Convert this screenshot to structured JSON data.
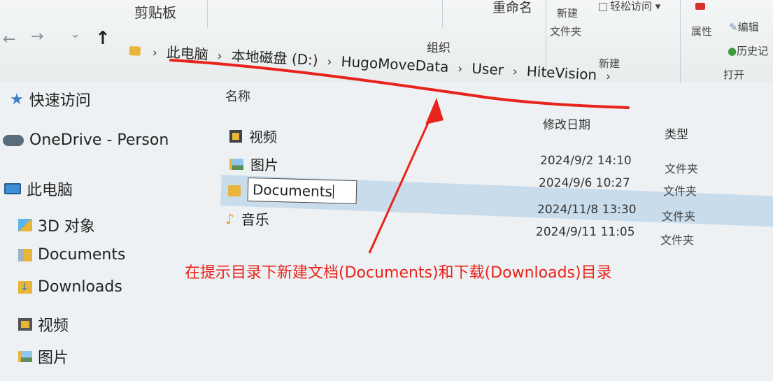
{
  "ribbon": {
    "clipboard_label": "剪贴板",
    "rename_label": "重命名",
    "new_folder_label_line1": "新建",
    "new_folder_label_line2": "文件夹",
    "easy_access_label": "轻松访问 ▾",
    "organize_group": "组织",
    "new_group": "新建",
    "properties_label": "属性",
    "edit_label": "编辑",
    "history_label": "历史记",
    "open_group": "打开"
  },
  "nav": {
    "back": "←",
    "forward": "→",
    "recent": "⌄",
    "up": "↑"
  },
  "breadcrumb": [
    "此电脑",
    "本地磁盘 (D:)",
    "HugoMoveData",
    "User",
    "HiteVision"
  ],
  "breadcrumb_sep": "›",
  "sidebar": {
    "items": [
      {
        "label": "快速访问",
        "icon": "star-icon"
      },
      {
        "label": "OneDrive - Person",
        "icon": "cloud-icon"
      },
      {
        "label": "此电脑",
        "icon": "computer-icon"
      },
      {
        "label": "3D 对象",
        "icon": "cube-icon"
      },
      {
        "label": "Documents",
        "icon": "document-folder-icon"
      },
      {
        "label": "Downloads",
        "icon": "download-folder-icon"
      },
      {
        "label": "视频",
        "icon": "video-folder-icon"
      },
      {
        "label": "图片",
        "icon": "picture-folder-icon"
      }
    ]
  },
  "columns": {
    "name": "名称",
    "modified": "修改日期",
    "type": "类型"
  },
  "files": [
    {
      "name": "视频",
      "date": "2024/9/2 14:10",
      "type": "文件夹",
      "icon": "video-folder-icon"
    },
    {
      "name": "图片",
      "date": "2024/9/6 10:27",
      "type": "文件夹",
      "icon": "picture-folder-icon"
    },
    {
      "name": "Documents",
      "date": "2024/11/8 13:30",
      "type": "文件夹",
      "icon": "folder-icon",
      "renaming": true
    },
    {
      "name": "音乐",
      "date": "2024/9/11 11:05",
      "type": "文件夹",
      "icon": "music-folder-icon"
    }
  ],
  "annotation": {
    "caption": "在提示目录下新建文档(Documents)和下载(Downloads)目录",
    "color": "#e8231b"
  },
  "colors": {
    "selection": "#c9dcec",
    "folder": "#e8b53a"
  }
}
